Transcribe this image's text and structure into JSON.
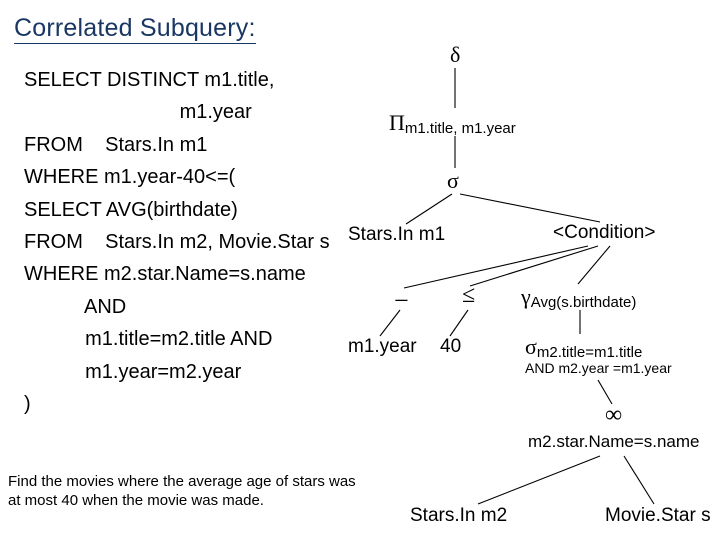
{
  "title": "Correlated Subquery:",
  "sql": {
    "l1a": "SELECT DISTINCT m1.title,",
    "l1b": "                            m1.year",
    "l2": "FROM    Stars.In m1",
    "l3": "WHERE m1.year-40<=(",
    "l4": "SELECT AVG(birthdate)",
    "l5": "FROM    Stars.In m2, Movie.Star s",
    "l6": "WHERE m2.star.Name=s.name",
    "l7": "           AND",
    "l8": "           m1.title=m2.title AND",
    "l9": "           m1.year=m2.year",
    "l10": ")"
  },
  "caption": "Find the movies where the average age of stars was at most 40 when the movie was made.",
  "tree": {
    "delta_op": "δ",
    "pi_op": "Π",
    "pi_sub": "m1.title, m1.year",
    "sigma_op": "σ",
    "starsin_m1": "Stars.In m1",
    "condition": "<Condition>",
    "minus": "−",
    "leq": "≤",
    "m1year": "m1.year",
    "forty": "40",
    "gamma_op": "γ",
    "gamma_sub": "Avg(s.birthdate)",
    "sigma2_op": "σ",
    "sigma2_sub_l1": "m2.title=m1.title",
    "sigma2_sub_l2": "AND m2.year =m1.year",
    "join_op": "∞",
    "join_sub": "m2.star.Name=s.name",
    "starsin_m2": "Stars.In m2",
    "moviestar": "Movie.Star s"
  }
}
